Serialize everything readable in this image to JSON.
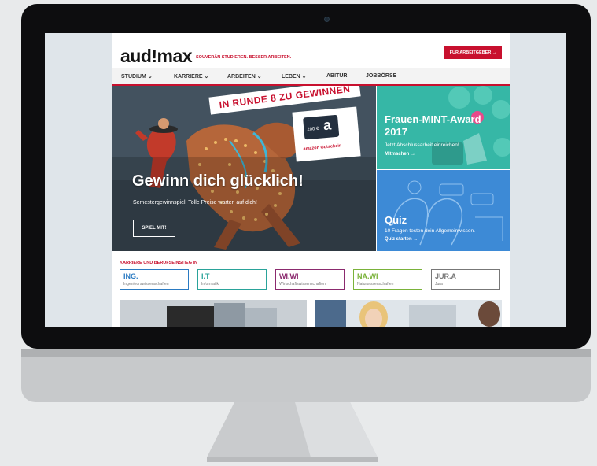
{
  "header": {
    "logo": "aud!max",
    "tagline": "SOUVERÄN STUDIEREN. BESSER ARBEITEN.",
    "employer_button": "FÜR ARBEITGEBER →"
  },
  "nav": {
    "items": [
      {
        "label": "STUDIUM ⌄"
      },
      {
        "label": "KARRIERE ⌄"
      },
      {
        "label": "ARBEITEN ⌄"
      },
      {
        "label": "LEBEN ⌄"
      },
      {
        "label": "ABITUR"
      },
      {
        "label": "JOBBÖRSE"
      }
    ]
  },
  "hero": {
    "banner": "IN RUNDE 8 ZU GEWINNEN",
    "voucher_amount": "200 €",
    "voucher_brand": "a",
    "voucher_label": "amazon Gutschein",
    "title": "Gewinn dich glücklich!",
    "subtitle": "Semestergewinnspiel: Tolle Preise warten auf dich!",
    "button": "SPIEL MIT!"
  },
  "teasers": [
    {
      "title1": "Frauen-MINT-Award",
      "title2": "2017",
      "subtitle": "Jetzt Abschlussarbeit einreichen!",
      "link": "Mitmachen →",
      "color": "#36b7a6"
    },
    {
      "title1": "Quiz",
      "subtitle": "10 Fragen testen dein Allgemeinwissen.",
      "link": "Quiz starten →",
      "color": "#3d8ad6"
    }
  ],
  "careers": {
    "heading": "KARRIERE UND BERUFSEINSTIEG IN",
    "items": [
      {
        "title": "ING.",
        "subtitle": "Ingenieurswissenschaften",
        "color": "#2a7ac2"
      },
      {
        "title": "I.T",
        "subtitle": "Informatik",
        "color": "#2aa39a"
      },
      {
        "title": "WI.WI",
        "subtitle": "Wirtschaftswissenschaften",
        "color": "#8b2a6e"
      },
      {
        "title": "NA.WI",
        "subtitle": "Naturwissenschaften",
        "color": "#7ab23a"
      },
      {
        "title": "JUR.A",
        "subtitle": "Jura",
        "color": "#777777"
      }
    ]
  },
  "colors": {
    "brand_red": "#c8102e",
    "bezel": "#0d0d0f"
  }
}
